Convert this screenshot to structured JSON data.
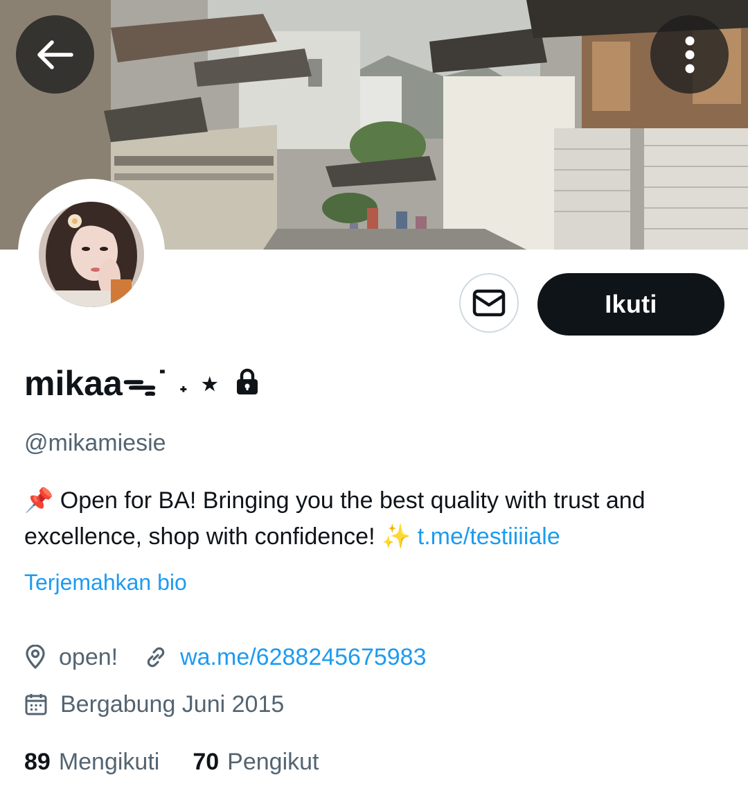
{
  "profile": {
    "display_name": "mikaaᯓ˙ ˖ ⋆",
    "handle": "@mikamiesie",
    "protected": true
  },
  "actions": {
    "follow_label": "Ikuti"
  },
  "bio": {
    "pin_emoji": "📌",
    "text_main": " Open for BA! Bringing you the best quality with trust and excellence, shop with confidence! ",
    "sparkle_emoji": "✨",
    "link_text": "t.me/testiiiiale",
    "translate_label": "Terjemahkan bio"
  },
  "meta": {
    "location": "open!",
    "website": "wa.me/6288245675983",
    "joined": "Bergabung Juni 2015"
  },
  "stats": {
    "following_count": "89",
    "following_label": "Mengikuti",
    "followers_count": "70",
    "followers_label": "Pengikut"
  },
  "icons": {
    "back": "arrow-left-icon",
    "more": "more-vertical-icon",
    "message": "envelope-icon",
    "lock": "lock-icon",
    "location": "location-pin-icon",
    "link": "link-icon",
    "calendar": "calendar-icon"
  },
  "colors": {
    "accent": "#1d9bf0",
    "text_primary": "#0f1419",
    "text_secondary": "#536471",
    "follow_button": "#0f1419",
    "border": "#cfd9de"
  }
}
